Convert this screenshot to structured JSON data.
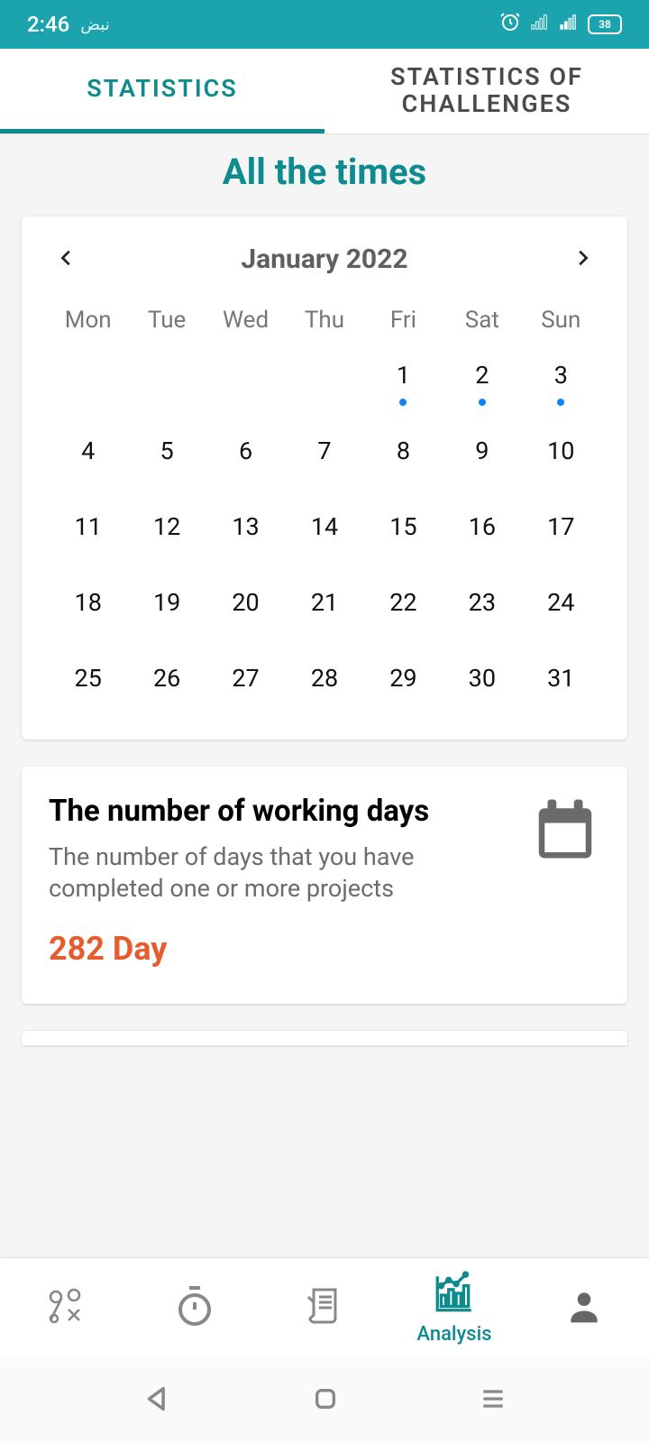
{
  "status_bar": {
    "time": "2:46",
    "app_label": "نبض",
    "battery": "38"
  },
  "tabs": [
    {
      "label": "STATISTICS",
      "active": true
    },
    {
      "label": "STATISTICS OF CHALLENGES",
      "active": false
    }
  ],
  "heading": "All the times",
  "calendar": {
    "month_label": "January 2022",
    "weekdays": [
      "Mon",
      "Tue",
      "Wed",
      "Thu",
      "Fri",
      "Sat",
      "Sun"
    ],
    "leading_empty": 4,
    "days": [
      {
        "n": 1,
        "dot": true
      },
      {
        "n": 2,
        "dot": true
      },
      {
        "n": 3,
        "dot": true
      },
      {
        "n": 4
      },
      {
        "n": 5
      },
      {
        "n": 6
      },
      {
        "n": 7
      },
      {
        "n": 8
      },
      {
        "n": 9
      },
      {
        "n": 10
      },
      {
        "n": 11
      },
      {
        "n": 12
      },
      {
        "n": 13
      },
      {
        "n": 14
      },
      {
        "n": 15
      },
      {
        "n": 16
      },
      {
        "n": 17
      },
      {
        "n": 18
      },
      {
        "n": 19
      },
      {
        "n": 20
      },
      {
        "n": 21
      },
      {
        "n": 22
      },
      {
        "n": 23
      },
      {
        "n": 24
      },
      {
        "n": 25
      },
      {
        "n": 26
      },
      {
        "n": 27
      },
      {
        "n": 28
      },
      {
        "n": 29
      },
      {
        "n": 30
      },
      {
        "n": 31
      }
    ]
  },
  "stat_card": {
    "title": "The number of working days",
    "desc": "The number of days that you have completed one or more projects",
    "value": "282 Day"
  },
  "bottom_nav": {
    "active_label": "Analysis"
  },
  "colors": {
    "accent": "#0d8b8f",
    "stat_value": "#e65c2e",
    "statusbar": "#1ba3ae"
  }
}
